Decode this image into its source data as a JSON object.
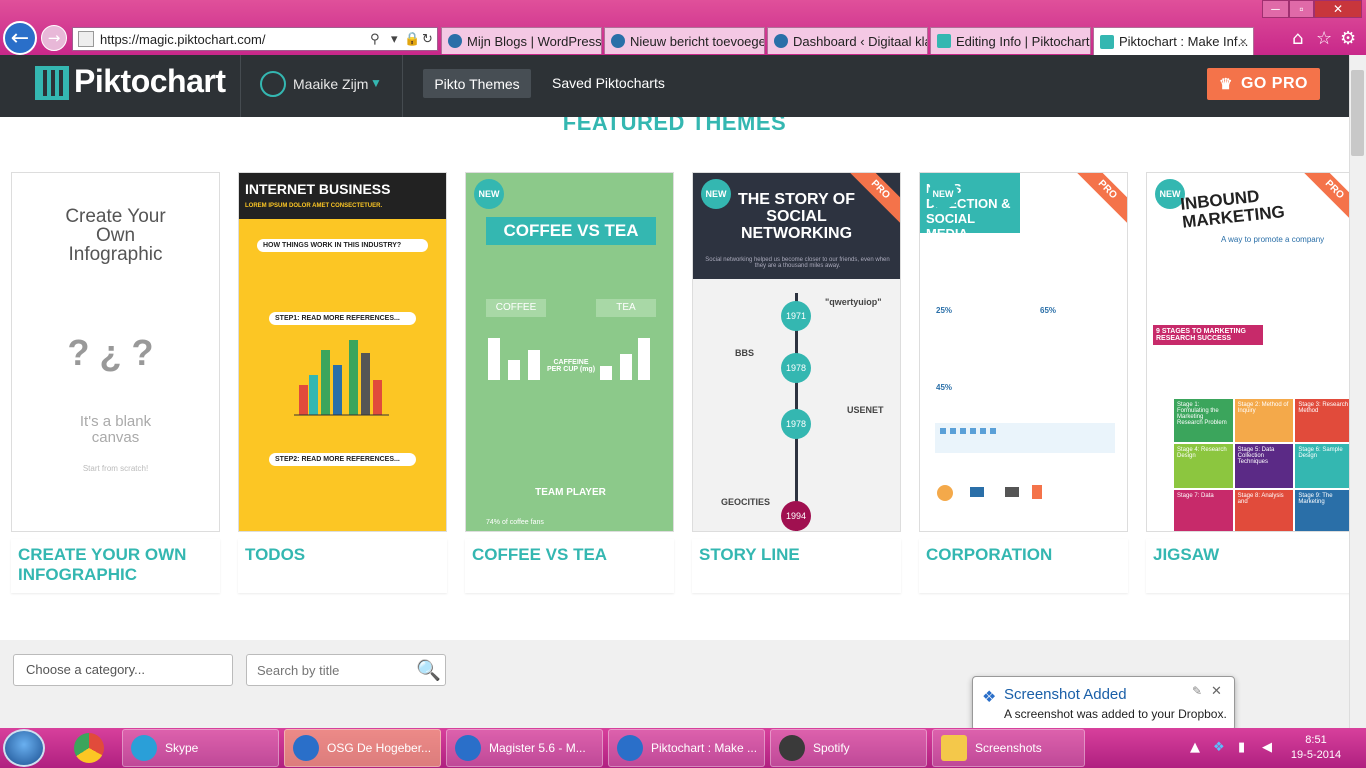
{
  "browser": {
    "url": "https://magic.piktochart.com/",
    "tabs": [
      {
        "label": "Mijn Blogs | WordPress...."
      },
      {
        "label": "Nieuw bericht toevoege..."
      },
      {
        "label": "Dashboard ‹ Digitaal kla..."
      },
      {
        "label": "Editing Info | Piktochart..."
      },
      {
        "label": "Piktochart : Make Inf..."
      }
    ]
  },
  "header": {
    "logo": "Piktochart",
    "user": "Maaike Zijm",
    "nav_themes": "Pikto Themes",
    "nav_saved": "Saved Piktocharts",
    "go_pro": "GO PRO"
  },
  "main": {
    "section_title": "FEATURED THEMES",
    "themes": [
      {
        "name": "CREATE YOUR OWN INFOGRAPHIC",
        "thumb_title": "Create Your Own Infographic",
        "thumb_sub": "It's a blank canvas",
        "thumb_small": "Start from scratch!"
      },
      {
        "name": "TODOS",
        "thumb_title": "INTERNET BUSINESS",
        "thumb_sub": "LOREM IPSUM DOLOR AMET CONSECTETUER.",
        "thumb_q": "HOW THINGS WORK IN THIS INDUSTRY?",
        "thumb_step1": "STEP1: READ MORE REFERENCES...",
        "thumb_step2": "STEP2: READ MORE REFERENCES..."
      },
      {
        "name": "COFFEE VS TEA",
        "badge": "NEW",
        "thumb_title": "COFFEE VS TEA",
        "thumb_l": "COFFEE",
        "thumb_r": "TEA",
        "thumb_caffeine": "CAFFEINE PER CUP (mg)",
        "thumb_team": "TEAM PLAYER",
        "thumb_pct": "74% of coffee fans"
      },
      {
        "name": "STORY LINE",
        "badge": "NEW",
        "pro": "PRO",
        "thumb_title": "THE STORY OF SOCIAL NETWORKING",
        "thumb_sub": "Social networking helped us become closer to our friends, even when they are a thousand miles away.",
        "years": [
          "1971",
          "1978",
          "1978",
          "1994"
        ],
        "labels": [
          "BBS",
          "\"qwertyuiop\"",
          "USENET",
          "GEOCITIES"
        ]
      },
      {
        "name": "CORPORATION",
        "badge": "NEW",
        "pro": "PRO",
        "thumb_title": "NESS DIRECTION & SOCIAL MEDIA",
        "pcts": [
          "25%",
          "65%",
          "45%"
        ]
      },
      {
        "name": "JIGSAW",
        "badge": "NEW",
        "pro": "PRO",
        "thumb_title": "INBOUND MARKETING",
        "thumb_sub": "A way to promote a company",
        "thumb_stages": "9 STAGES TO MARKETING RESEARCH SUCCESS",
        "pieces": [
          "Stage 1: Formulating the Marketing Research Problem",
          "Stage 2: Method of Inquiry",
          "Stage 3: Research Method",
          "Stage 4: Research Design",
          "Stage 5: Data Collection Techniques",
          "Stage 6: Sample Design",
          "Stage 7: Data",
          "Stage 8: Analysis and",
          "Stage 9: The Marketing"
        ]
      }
    ],
    "category_placeholder": "Choose a category...",
    "search_placeholder": "Search by title"
  },
  "toast": {
    "title": "Screenshot Added",
    "message": "A screenshot was added to your Dropbox."
  },
  "taskbar": {
    "items": [
      {
        "label": "Skype"
      },
      {
        "label": "OSG De Hogeber..."
      },
      {
        "label": "Magister 5.6 - M..."
      },
      {
        "label": "Piktochart : Make ..."
      },
      {
        "label": "Spotify"
      },
      {
        "label": "Screenshots"
      }
    ],
    "time": "8:51",
    "date": "19-5-2014"
  },
  "colors": {
    "accent": "#34b7b1",
    "pro": "#f4734a",
    "header": "#2d3236",
    "browser": "#d8409c"
  }
}
